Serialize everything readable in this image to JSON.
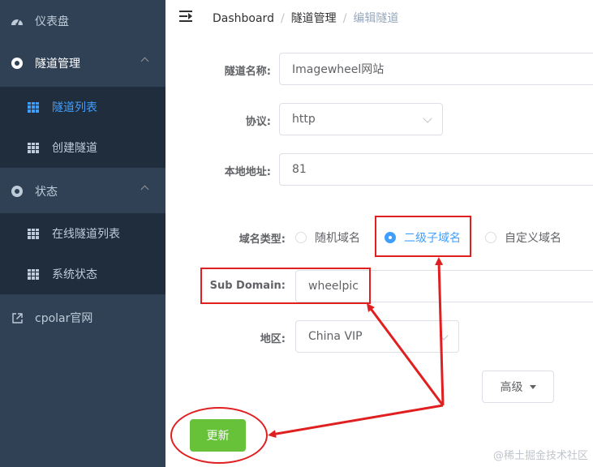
{
  "sidebar": {
    "dashboard": "仪表盘",
    "tunnel_mgmt": "隧道管理",
    "tunnel_list": "隧道列表",
    "create_tunnel": "创建隧道",
    "status": "状态",
    "online_tunnels": "在线隧道列表",
    "system_status": "系统状态",
    "cpolar_site": "cpolar官网"
  },
  "breadcrumb": {
    "home": "Dashboard",
    "sep": "/",
    "section": "隧道管理",
    "current": "编辑隧道"
  },
  "form": {
    "name_label": "隧道名称:",
    "name_value": "Imagewheel网站",
    "protocol_label": "协议:",
    "protocol_value": "http",
    "local_label": "本地地址:",
    "local_value": "81",
    "domain_type_label": "域名类型:",
    "domain_types": [
      "随机域名",
      "二级子域名",
      "自定义域名"
    ],
    "domain_type_selected": "二级子域名",
    "subdomain_label": "Sub Domain:",
    "subdomain_value": "wheelpic",
    "region_label": "地区:",
    "region_value": "China VIP",
    "advanced_label": "高级",
    "update_label": "更新"
  },
  "watermark": "@稀土掘金技术社区",
  "colors": {
    "sidebar_bg": "#304156",
    "submenu_bg": "#1f2d3d",
    "active": "#409eff",
    "success": "#67c23a",
    "annotation": "#e02020"
  }
}
